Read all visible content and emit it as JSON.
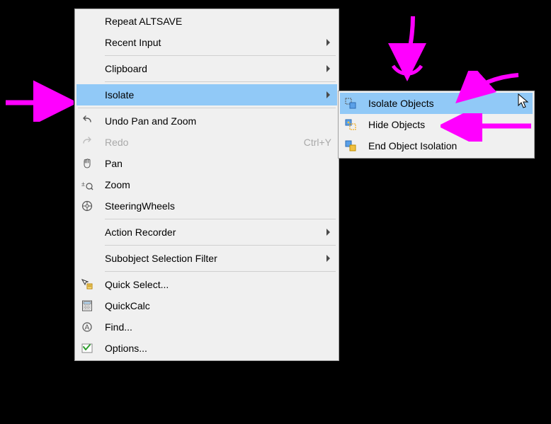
{
  "main_menu": {
    "items": [
      {
        "label": "Repeat ALTSAVE",
        "icon": "",
        "submenu": false
      },
      {
        "label": "Recent Input",
        "icon": "",
        "submenu": true
      },
      {
        "sep": true
      },
      {
        "label": "Clipboard",
        "icon": "",
        "submenu": true
      },
      {
        "sep": true
      },
      {
        "label": "Isolate",
        "icon": "",
        "submenu": true,
        "highlight": true
      },
      {
        "sepfull": true
      },
      {
        "label": "Undo Pan and Zoom",
        "icon": "undo-icon",
        "submenu": false
      },
      {
        "label": "Redo",
        "icon": "redo-icon",
        "submenu": false,
        "shortcut": "Ctrl+Y",
        "disabled": true
      },
      {
        "label": "Pan",
        "icon": "pan-icon",
        "submenu": false
      },
      {
        "label": "Zoom",
        "icon": "zoom-icon",
        "submenu": false
      },
      {
        "label": "SteeringWheels",
        "icon": "steering-icon",
        "submenu": false
      },
      {
        "sep": true
      },
      {
        "label": "Action Recorder",
        "icon": "",
        "submenu": true
      },
      {
        "sep": true
      },
      {
        "label": "Subobject Selection Filter",
        "icon": "",
        "submenu": true
      },
      {
        "sep": true
      },
      {
        "label": "Quick Select...",
        "icon": "quickselect-icon",
        "submenu": false
      },
      {
        "label": "QuickCalc",
        "icon": "quickcalc-icon",
        "submenu": false
      },
      {
        "label": "Find...",
        "icon": "find-icon",
        "submenu": false
      },
      {
        "label": "Options...",
        "icon": "options-icon",
        "submenu": false
      }
    ]
  },
  "sub_menu": {
    "items": [
      {
        "label": "Isolate Objects",
        "icon": "isolate-objects-icon",
        "highlight": true
      },
      {
        "label": "Hide Objects",
        "icon": "hide-objects-icon"
      },
      {
        "label": "End Object Isolation",
        "icon": "end-isolation-icon"
      }
    ]
  },
  "annotation_color": "#ff00ff"
}
